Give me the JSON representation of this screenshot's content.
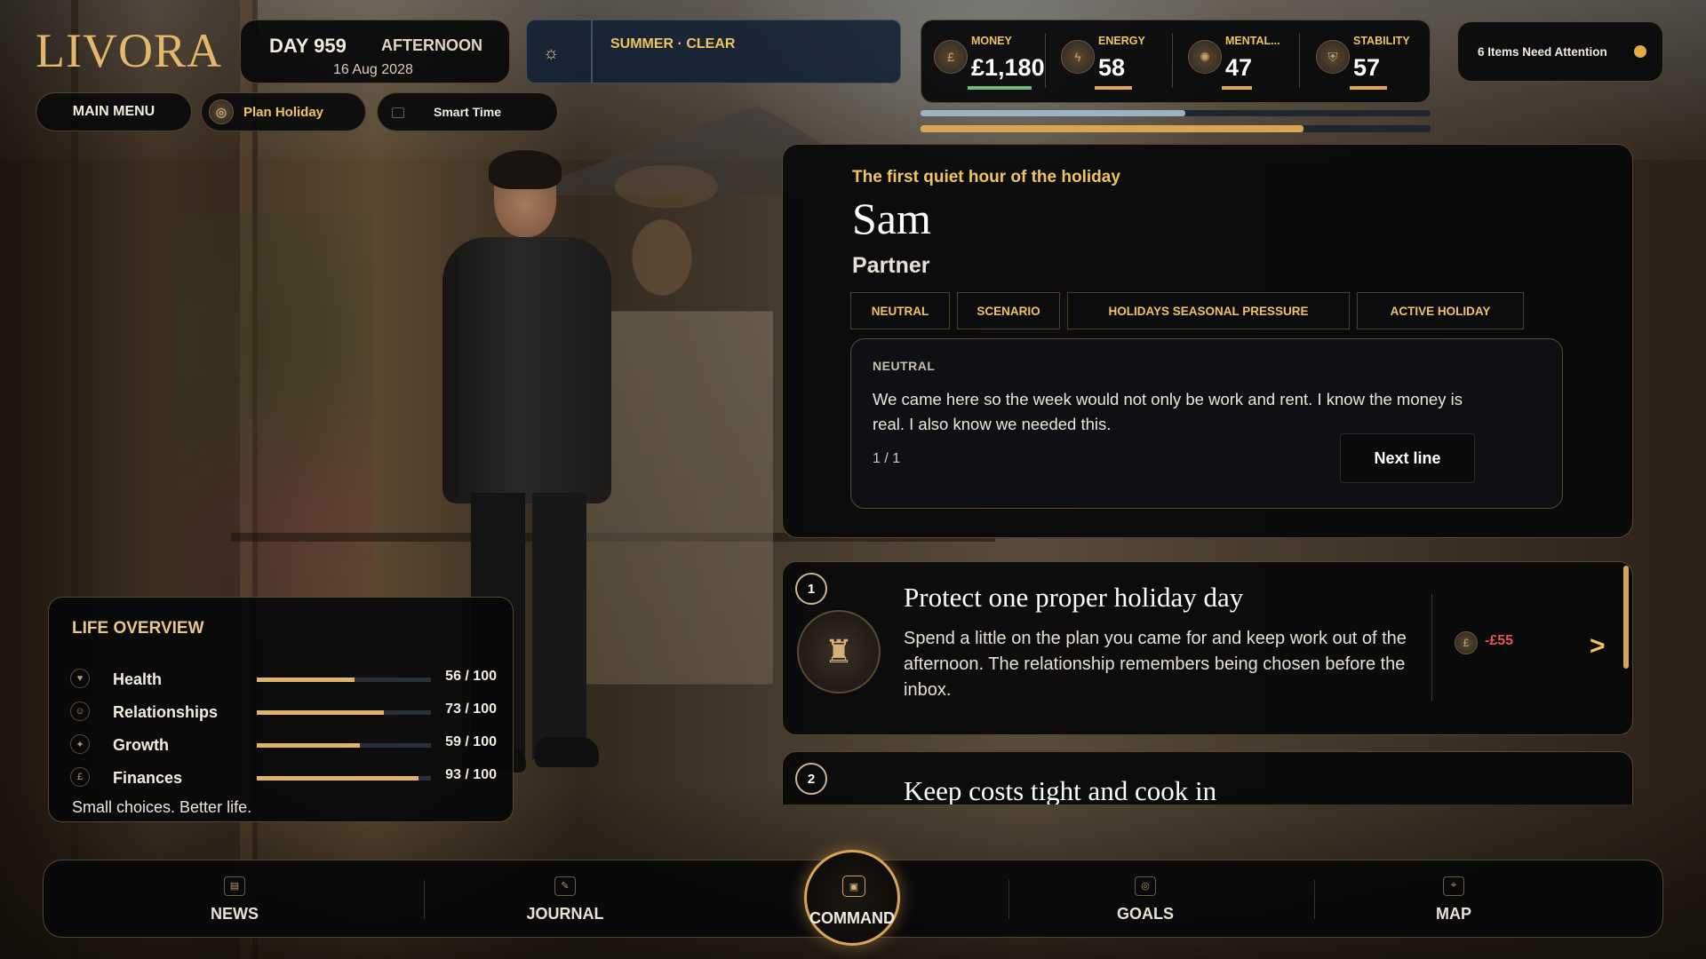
{
  "app": {
    "logo": "LIVORA"
  },
  "time": {
    "day": "DAY 959",
    "phase": "AFTERNOON",
    "date": "16 Aug 2028"
  },
  "weather": {
    "label": "SUMMER · CLEAR",
    "icon": "sun-icon"
  },
  "stats": [
    {
      "label": "MONEY",
      "value": "£1,180",
      "icon": "coin-icon"
    },
    {
      "label": "ENERGY",
      "value": "58",
      "icon": "lightning-icon"
    },
    {
      "label": "MENTAL...",
      "value": "47",
      "icon": "brain-icon"
    },
    {
      "label": "STABILITY",
      "value": "57",
      "icon": "shield-icon"
    }
  ],
  "progress": {
    "upper": 0.52,
    "lower": 0.75
  },
  "attention": {
    "label": "6 Items Need Attention"
  },
  "actions": {
    "main_menu": "MAIN MENU",
    "plan_holiday": "Plan Holiday",
    "smart_time": "Smart Time"
  },
  "dialogue": {
    "hint": "The first quiet hour of the holiday",
    "name": "Sam",
    "role": "Partner",
    "tags": [
      "NEUTRAL",
      "SCENARIO",
      "HOLIDAYS SEASONAL PRESSURE",
      "ACTIVE HOLIDAY"
    ],
    "mood": "NEUTRAL",
    "line": "We came here so the week would not only be work and rent. I know the money is real. I also know we needed this.",
    "counter": "1 / 1",
    "next_label": "Next line"
  },
  "choices": [
    {
      "number": "1",
      "title": "Protect one proper holiday day",
      "description": "Spend a little on the plan you came for and keep work out of the afternoon. The relationship remembers being chosen before the inbox.",
      "cost": "-£55",
      "arrow": ">"
    },
    {
      "number": "2",
      "title": "Keep costs tight and cook in"
    }
  ],
  "life_overview": {
    "title": "LIFE OVERVIEW",
    "rows": [
      {
        "name": "Health",
        "value": "56 / 100",
        "level": 0.56
      },
      {
        "name": "Relationships",
        "value": "73 / 100",
        "level": 0.73
      },
      {
        "name": "Growth",
        "value": "59 / 100",
        "level": 0.59
      },
      {
        "name": "Finances",
        "value": "93 / 100",
        "level": 0.93
      }
    ],
    "tagline": "Small choices. Better life."
  },
  "nav": {
    "news": "NEWS",
    "journal": "JOURNAL",
    "command": "COMMAND",
    "goals": "GOALS",
    "map": "MAP"
  },
  "colors": {
    "accent": "#e4a84a",
    "gold_text": "#f0c45e",
    "cost_red": "#e4574a"
  }
}
